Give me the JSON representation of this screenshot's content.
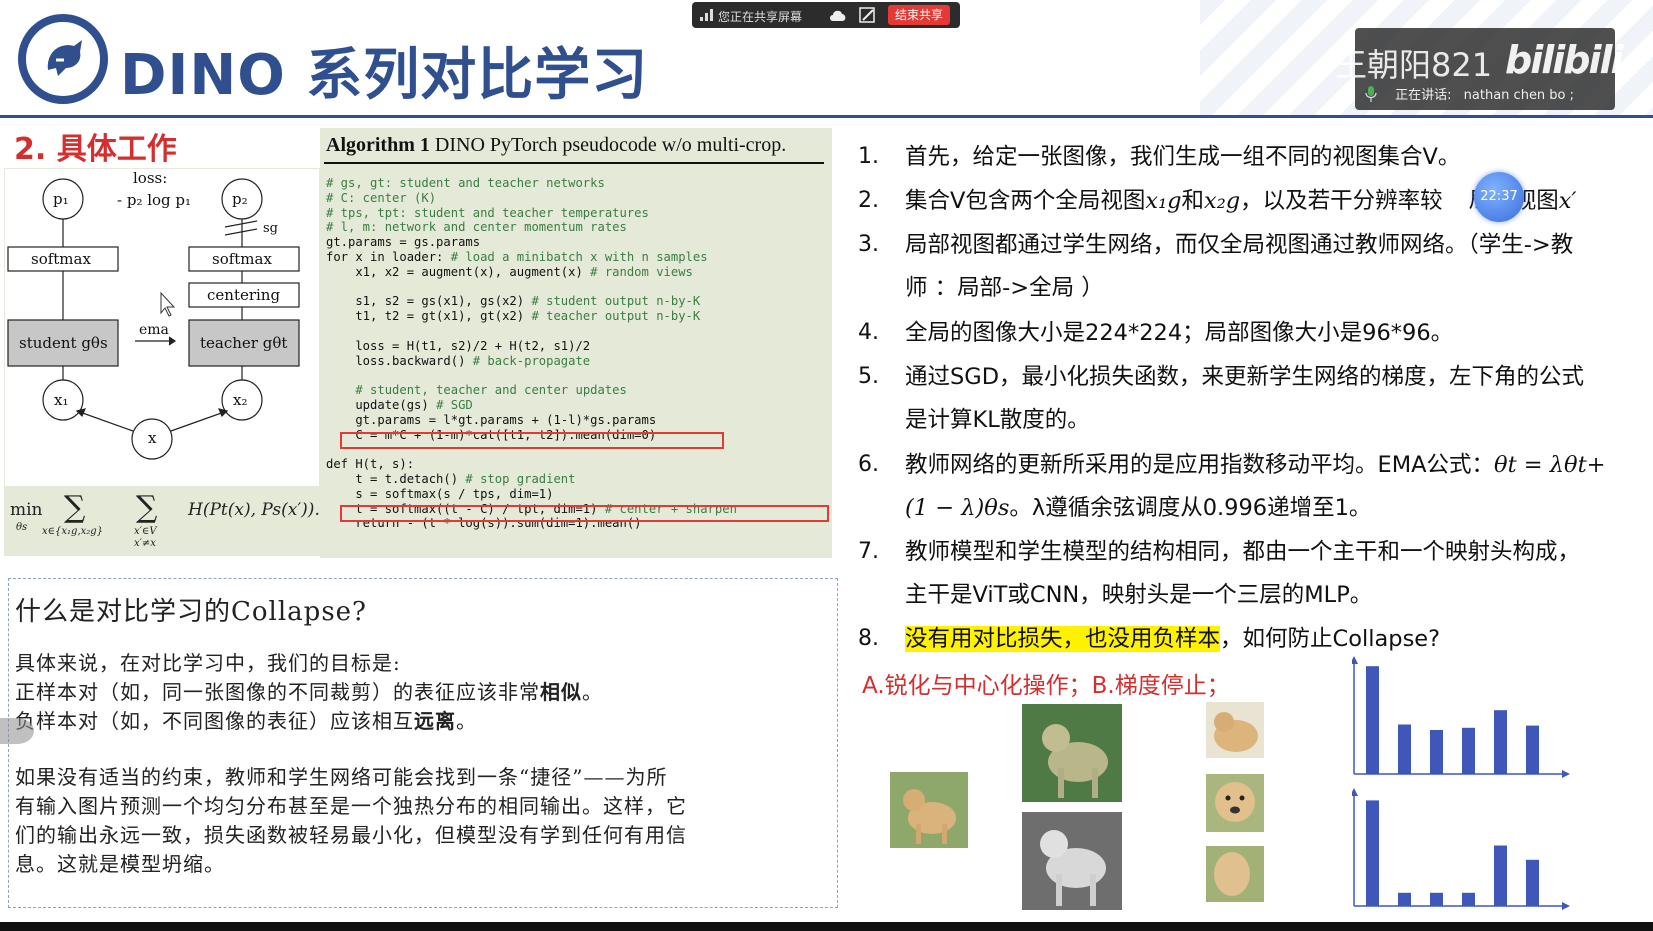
{
  "sharebar": {
    "sharing_text": "您正在共享屏幕",
    "end_share_label": "结束共享"
  },
  "streamer": {
    "name": "王朝阳821",
    "platform_logo": "bilibili",
    "speaker_label": "正在讲话:",
    "speaker_name": "nathan chen bo ;"
  },
  "slide": {
    "title": "DINO 系列对比学习",
    "section_heading": "2. 具体工作",
    "accent_color": "#2f4f8f",
    "heading_color": "#d32f2f"
  },
  "diagram": {
    "loss_label": "loss:",
    "loss_formula": "- p₂ log p₁",
    "p1": "p₁",
    "p2": "p₂",
    "sg": "sg",
    "softmax_left": "softmax",
    "softmax_right": "softmax",
    "centering": "centering",
    "student": "student gθs",
    "teacher": "teacher gθt",
    "ema": "ema",
    "x1": "x₁",
    "x2": "x₂",
    "x": "x"
  },
  "formula": {
    "min": "min",
    "theta_s": "θs",
    "sum1_sub": "x∈{x₁g,x₂g}",
    "sum2_sub1": "x′∈V",
    "sum2_sub2": "x′≠x",
    "expr": "H(Pt(x), Ps(x′))."
  },
  "algorithm": {
    "title_bold": "Algorithm 1",
    "title_rest": " DINO PyTorch pseudocode w/o multi-crop.",
    "lines": [
      {
        "code": "",
        "comment": "# gs, gt: student and teacher networks"
      },
      {
        "code": "",
        "comment": "# C: center (K)"
      },
      {
        "code": "",
        "comment": "# tps, tpt: student and teacher temperatures"
      },
      {
        "code": "",
        "comment": "# l, m: network and center momentum rates"
      },
      {
        "code": "gt.params = gs.params",
        "comment": ""
      },
      {
        "code": "for x in loader: ",
        "comment": "# load a minibatch x with n samples"
      },
      {
        "code": "    x1, x2 = augment(x), augment(x) ",
        "comment": "# random views"
      },
      {
        "code": "",
        "comment": ""
      },
      {
        "code": "    s1, s2 = gs(x1), gs(x2) ",
        "comment": "# student output n-by-K"
      },
      {
        "code": "    t1, t2 = gt(x1), gt(x2) ",
        "comment": "# teacher output n-by-K"
      },
      {
        "code": "",
        "comment": ""
      },
      {
        "code": "    loss = H(t1, s2)/2 + H(t2, s1)/2",
        "comment": ""
      },
      {
        "code": "    loss.backward() ",
        "comment": "# back-propagate"
      },
      {
        "code": "",
        "comment": ""
      },
      {
        "code": "    ",
        "comment": "# student, teacher and center updates"
      },
      {
        "code": "    update(gs) ",
        "comment": "# SGD"
      },
      {
        "code": "    gt.params = l*gt.params + (1-l)*gs.params",
        "comment": ""
      },
      {
        "code": "    C = m*C + (1-m)*cat([t1, t2]).mean(dim=0)",
        "comment": ""
      },
      {
        "code": "",
        "comment": ""
      },
      {
        "code": "def H(t, s):",
        "comment": ""
      },
      {
        "code": "    t = t.detach() ",
        "comment": "# stop gradient"
      },
      {
        "code": "    s = softmax(s / tps, dim=1)",
        "comment": ""
      },
      {
        "code": "    t = softmax((t - C) / tpt, dim=1) ",
        "comment": "# center + sharpen"
      },
      {
        "code": "    return - (t * log(s)).sum(dim=1).mean()",
        "comment": ""
      }
    ]
  },
  "collapse": {
    "question": "什么是对比学习的Collapse?",
    "para1_l1": "具体来说，在对比学习中，我们的目标是:",
    "para1_l2a": "正样本对（如，同一张图像的不同裁剪）的表征应该非常",
    "para1_l2b": "相似",
    "para1_l2c": "。",
    "para1_l3a": "负样本对（如，不同图像的表征）应该相互",
    "para1_l3b": "远离",
    "para1_l3c": "。",
    "para2_l1": "如果没有适当的约束，教师和学生网络可能会找到一条“捷径”——为所",
    "para2_l2": "有输入图片预测一个均匀分布甚至是一个独热分布的相同输出。这样，它",
    "para2_l3": "们的输出永远一致，损失函数被轻易最小化，但模型没有学到任何有用信",
    "para2_l4": "息。这就是模型坍缩。"
  },
  "list": {
    "i1_num": "1.",
    "i1": "首先，给定一张图像，我们生成一组不同的视图集合V。",
    "i2_num": "2.",
    "i2a": "集合V包含两个全局视图",
    "i2_m1": "x₁g",
    "i2b": "和",
    "i2_m2": "x₂g",
    "i2c": "，以及若干分辨率较",
    "i2d": "局部视图",
    "i2_m3": "x′",
    "i3_num": "3.",
    "i3a": "局部视图都通过学生网络，而仅全局视图通过教师网络。（学生->教",
    "i3b": "师  ：局部->全局 ）",
    "i4_num": "4.",
    "i4": "全局的图像大小是224*224；局部图像大小是96*96。",
    "i5_num": "5.",
    "i5a": "通过SGD，最小化损失函数，来更新学生网络的梯度，左下角的公式",
    "i5b": "是计算KL散度的。",
    "i6_num": "6.",
    "i6a": "教师网络的更新所采用的是应用指数移动平均。EMA公式：",
    "i6_m1": "θt = λθt+",
    "i6_m2": "(1 − λ)θs",
    "i6b": "。λ遵循余弦调度从0.996递增至1。",
    "i7_num": "7.",
    "i7a": " 教师模型和学生模型的结构相同，都由一个主干和一个映射头构成，",
    "i7b": "主干是ViT或CNN，映射头是一个三层的MLP。",
    "i8_num": "8.",
    "i8_hl": "没有用对比损失，也没用负样本",
    "i8_rest": "，如何防止Collapse?",
    "answer": "A.锐化与中心化操作；B.梯度停止；"
  },
  "timer": "22:37",
  "chart_data": [
    {
      "type": "bar",
      "values": [
        0.98,
        0.45,
        0.4,
        0.42,
        0.58,
        0.44
      ],
      "ylim": [
        0,
        1
      ],
      "color": "#3f57b8"
    },
    {
      "type": "bar",
      "values": [
        0.96,
        0.12,
        0.12,
        0.12,
        0.55,
        0.42
      ],
      "ylim": [
        0,
        1
      ],
      "color": "#3f57b8"
    }
  ]
}
